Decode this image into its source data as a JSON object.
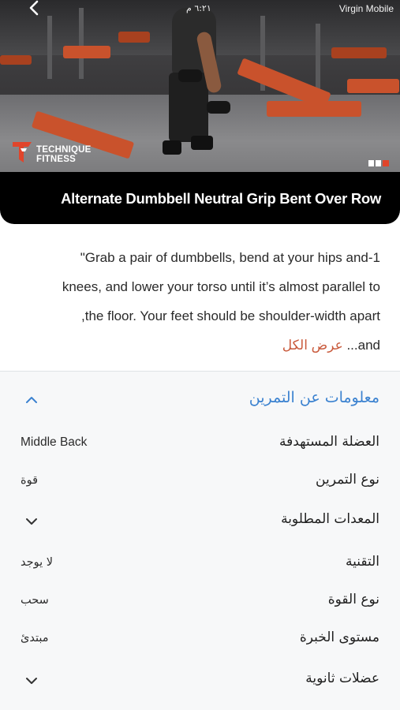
{
  "status_bar": {
    "carrier": "Virgin Mobile",
    "time": "٦:٢١ م"
  },
  "video": {
    "brand_line1": "TECHNIQUE",
    "brand_line2": "FITNESS"
  },
  "exercise": {
    "title": "Alternate Dumbbell Neutral Grip Bent Over Row",
    "description_lines": [
      "Grab a pair of dumbbells, bend at your hips and-1\"",
      "knees, and lower your torso until it’s almost parallel to",
      "the floor. Your feet should be shoulder-width apart,"
    ],
    "description_tail": "...and",
    "show_all": "عرض الكل"
  },
  "info": {
    "header": "معلومات عن التمرين",
    "rows": [
      {
        "label": "العضلة المستهدفة",
        "value": "Middle Back"
      },
      {
        "label": "نوع التمرين",
        "value": "قوة"
      },
      {
        "label": "المعدات المطلوبة",
        "value": ""
      },
      {
        "label": "التقنية",
        "value": "لا يوجد"
      },
      {
        "label": "نوع القوة",
        "value": "سحب"
      },
      {
        "label": "مستوى الخبرة",
        "value": "مبتدئ"
      },
      {
        "label": "عضلات ثانوية",
        "value": ""
      }
    ]
  },
  "colors": {
    "accent_blue": "#3b82d0",
    "link_orange": "#c95a3c",
    "brand_red": "#e0452b"
  },
  "icons": {
    "back": "chevron-left-icon",
    "collapse": "chevron-up-icon",
    "expand": "chevron-down-icon"
  }
}
